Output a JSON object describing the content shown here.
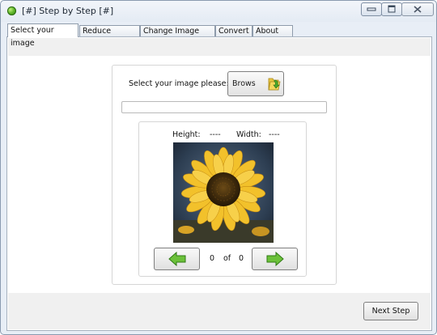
{
  "window": {
    "title": "[#] Step by Step [#]",
    "controls": {
      "minimize": "minimize-icon",
      "maximize": "maximize-icon",
      "close": "close-icon"
    }
  },
  "tabs": [
    {
      "label": "Select your image",
      "active": true
    },
    {
      "label": "Reduce Quality",
      "active": false
    },
    {
      "label": "Change Image Size",
      "active": false
    },
    {
      "label": "Convert",
      "active": false
    },
    {
      "label": "About Me",
      "active": false
    }
  ],
  "select_panel": {
    "prompt": "Select your image please:",
    "browse_label": "Brows",
    "path_value": "",
    "height_label": "Height:",
    "height_value": "----",
    "width_label": "Width:",
    "width_value": "----",
    "image_subject": "sunflower",
    "counter": {
      "current": "0",
      "of": "of",
      "total": "0"
    }
  },
  "footer": {
    "next_label": "Next Step"
  },
  "colors": {
    "window_bg": "#e8eef6",
    "strip_bg": "#f0f0f0",
    "arrow_green": "#5cb232"
  }
}
